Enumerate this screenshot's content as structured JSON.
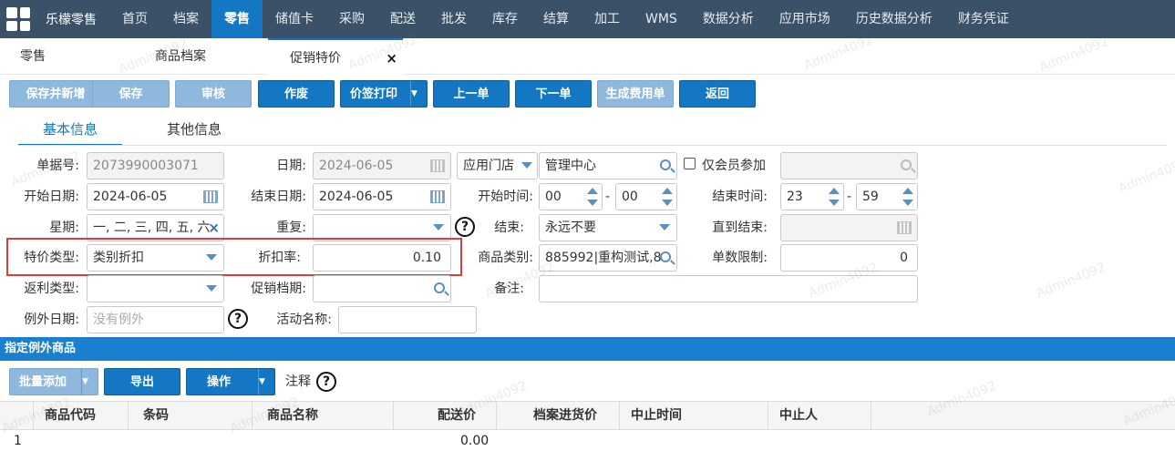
{
  "nav": {
    "brand": "乐檬零售",
    "items": [
      "首页",
      "档案",
      "零售",
      "储值卡",
      "采购",
      "配送",
      "批发",
      "库存",
      "结算",
      "加工",
      "WMS",
      "数据分析",
      "应用市场",
      "历史数据分析",
      "财务凭证"
    ]
  },
  "page_tabs": {
    "tab1": "零售",
    "tab2": "商品档案",
    "tab3": "促销特价",
    "close": "×"
  },
  "toolbar": {
    "save_new": "保存并新增",
    "save": "保存",
    "audit": "审核",
    "void": "作废",
    "price_print": "价签打印",
    "prev": "上一单",
    "next": "下一单",
    "gen_fee": "生成费用单",
    "back": "返回"
  },
  "info_tabs": {
    "basic": "基本信息",
    "other": "其他信息"
  },
  "form": {
    "doc_no_label": "单据号:",
    "doc_no": "2073990003071",
    "date_label": "日期:",
    "date": "2024-06-05",
    "store_select": "应用门店",
    "store_value": "管理中心",
    "member_only_label": "仅会员参加",
    "start_date_label": "开始日期:",
    "start_date": "2024-06-05",
    "end_date_label": "结束日期:",
    "end_date": "2024-06-05",
    "start_time_label": "开始时间:",
    "start_hour": "00",
    "start_min": "00",
    "end_time_label": "结束时间:",
    "end_hour": "23",
    "end_min": "59",
    "time_sep": "-",
    "weekday_label": "星期:",
    "weekday": "一, 二, 三, 四, 五, 六",
    "clear": "×",
    "repeat_label": "重复:",
    "repeat": "",
    "end_label": "结束:",
    "end_value": "永远不要",
    "until_end_label": "直到结束:",
    "special_type_label": "特价类型:",
    "special_type": "类别折扣",
    "discount_label": "折扣率:",
    "discount": "0.10",
    "category_label": "商品类别:",
    "category": "885992|重构测试,8",
    "order_limit_label": "单数限制:",
    "order_limit": "0",
    "rebate_type_label": "返利类型:",
    "promo_file_label": "促销档期:",
    "remark_label": "备注:",
    "exception_date_label": "例外日期:",
    "exception_date_placeholder": "没有例外",
    "activity_name_label": "活动名称:",
    "help": "?"
  },
  "exception_section": {
    "title": "指定例外商品",
    "batch_add": "批量添加",
    "export": "导出",
    "operate": "操作",
    "note": "注释",
    "columns": [
      "商品代码",
      "条码",
      "商品名称",
      "配送价",
      "档案进货价",
      "中止时间",
      "中止人"
    ],
    "rows": [
      {
        "index": "1",
        "delivery_price": "0.00"
      }
    ]
  },
  "watermark": "Admin4092"
}
